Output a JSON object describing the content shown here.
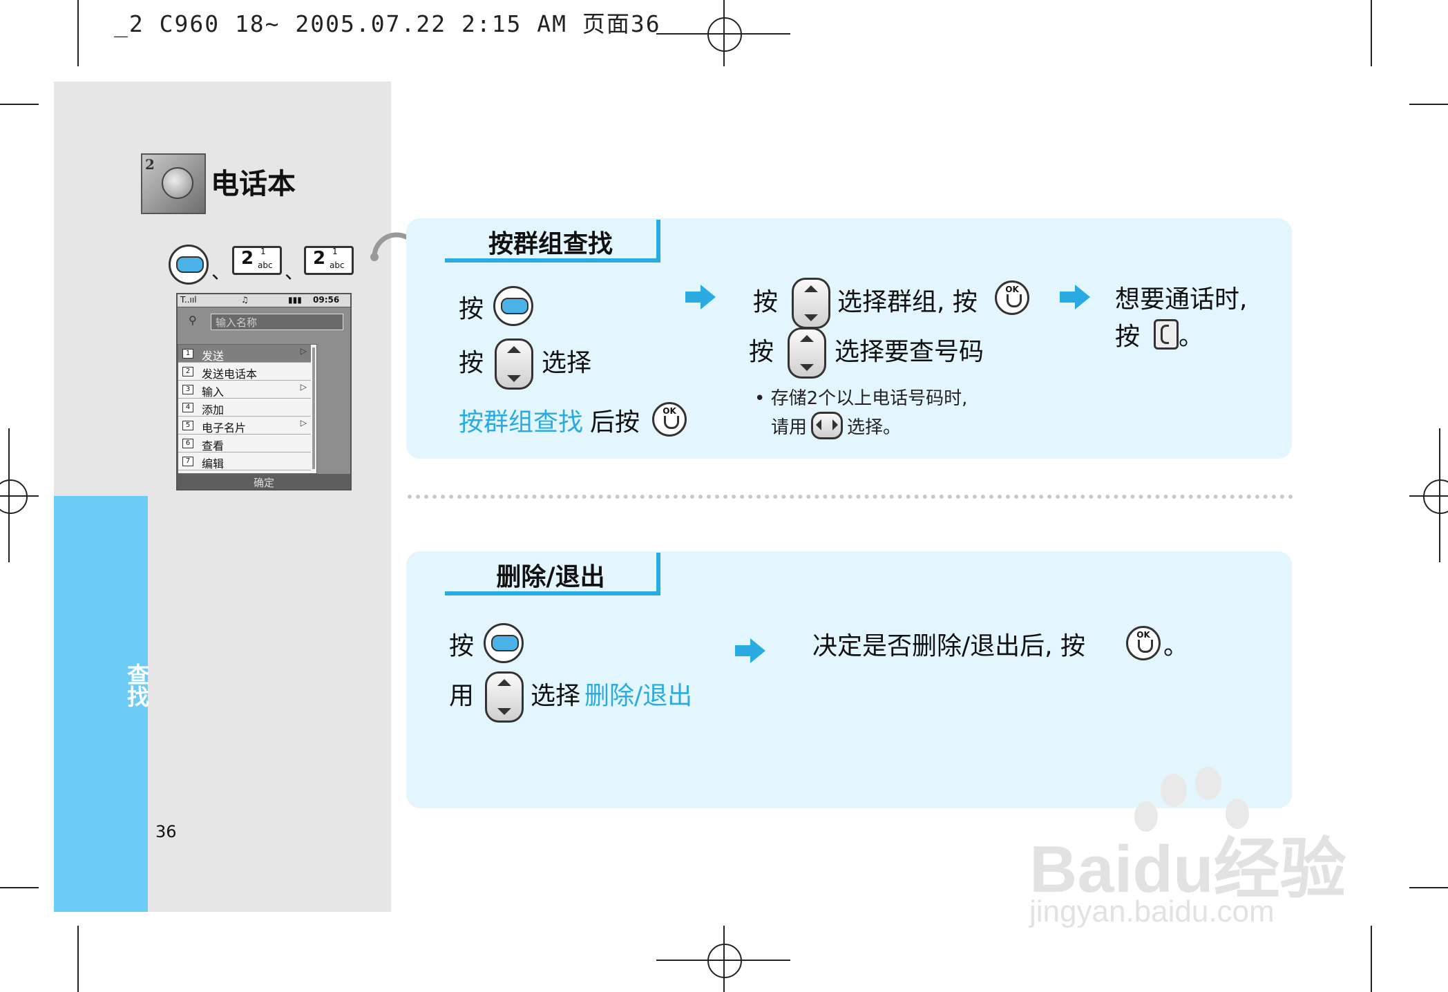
{
  "header_line": "_2 C960 18~  2005.07.22 2:15 AM  页面36",
  "chapter": {
    "title": "电话本",
    "icon": "phonebook-icon",
    "icon_number": "2",
    "side_tab": "查找",
    "page_number": "36"
  },
  "keys": {
    "num1": {
      "big": "2",
      "sup": "1",
      "sub": "abc"
    },
    "num2": {
      "big": "2",
      "sup": "1",
      "sub": "abc"
    },
    "separator": "、"
  },
  "phone_screen": {
    "status_signal": "T..ııl",
    "status_time": "09:56",
    "search_placeholder": "输入名称",
    "menu_items": [
      {
        "num": "1",
        "label": "发送",
        "arrow": "▷"
      },
      {
        "num": "2",
        "label": "发送电话本",
        "arrow": ""
      },
      {
        "num": "3",
        "label": "输入",
        "arrow": "▷"
      },
      {
        "num": "4",
        "label": "添加",
        "arrow": ""
      },
      {
        "num": "5",
        "label": "电子名片",
        "arrow": "▷"
      },
      {
        "num": "6",
        "label": "查看",
        "arrow": ""
      },
      {
        "num": "7",
        "label": "编辑",
        "arrow": ""
      }
    ],
    "softkey": "确定"
  },
  "section1": {
    "heading": "按群组查找",
    "step1_line1": "按",
    "step1_line2a": "按",
    "step1_line2b": "选择",
    "step1_line3_highlight": "按群组查找",
    "step1_line3_rest": "后按",
    "step2_line1a": "按",
    "step2_line1b": "选择群组, 按",
    "step2_line2a": "按",
    "step2_line2b": "选择要查号码",
    "note_line1": "• 存储2个以上电话号码时,",
    "note_line2a": "请用",
    "note_line2b": "选择。",
    "step3_line1": "想要通话时,",
    "step3_line2a": "按",
    "step3_line2b": "。"
  },
  "section2": {
    "heading": "删除/退出",
    "step1_line1": "按",
    "step1_line2a": "用",
    "step1_line2b": "选择",
    "step1_line2_highlight": "删除/退出",
    "step2_a": "决定是否删除/退出后, 按",
    "step2_b": "。"
  },
  "ok_label": "OK",
  "watermark": {
    "brand": "Baidu经验",
    "url": "jingyan.baidu.com"
  },
  "colors": {
    "accent": "#29abe2",
    "panel": "#e3f6fd",
    "sidebar_blue": "#6cccf5",
    "sidebar_gray": "#e6e6e6"
  }
}
